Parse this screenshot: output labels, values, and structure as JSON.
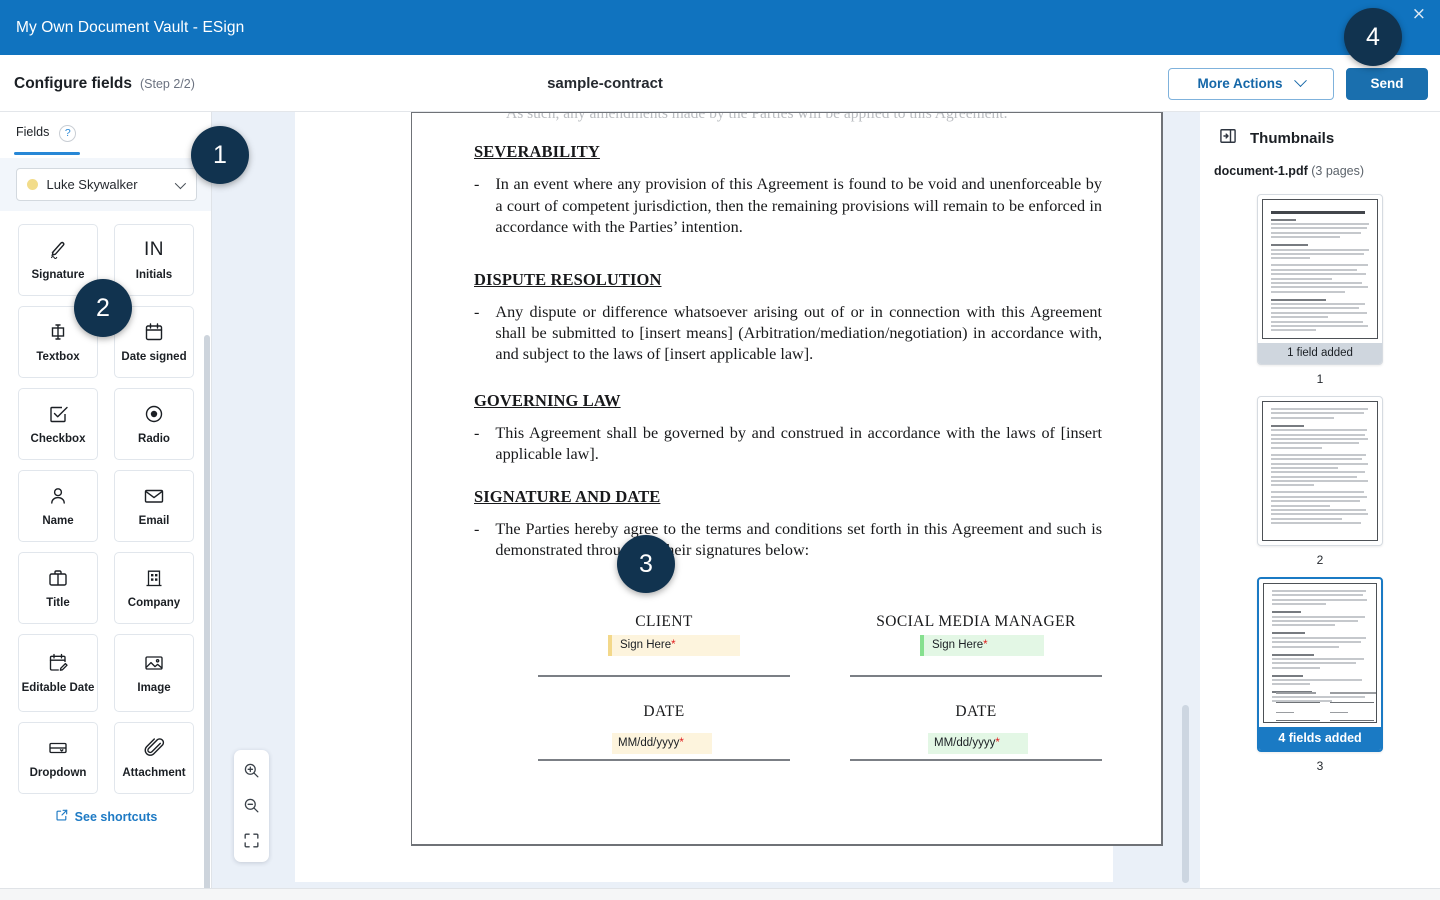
{
  "titlebar": {
    "title": "My Own Document Vault - ESign",
    "close_icon": "close-icon",
    "close_glyph": "×",
    "bg_color": "#1073bf"
  },
  "header": {
    "step_title": "Configure fields",
    "step_sub": "(Step 2/2)",
    "document_name": "sample-contract",
    "more_actions_label": "More Actions",
    "send_label": "Send",
    "send_color": "#1a6fae"
  },
  "left_panel": {
    "tab_label": "Fields",
    "help_glyph": "?",
    "recipient": {
      "name": "Luke Skywalker",
      "color": "#f2dc8a"
    },
    "fields": [
      {
        "label": "Signature",
        "icon": "signature-icon"
      },
      {
        "label": "Initials",
        "icon": "initials-icon",
        "glyph": "IN"
      },
      {
        "label": "Textbox",
        "icon": "textbox-icon"
      },
      {
        "label": "Date signed",
        "icon": "calendar-icon"
      },
      {
        "label": "Checkbox",
        "icon": "checkbox-icon"
      },
      {
        "label": "Radio",
        "icon": "radio-icon"
      },
      {
        "label": "Name",
        "icon": "person-icon"
      },
      {
        "label": "Email",
        "icon": "envelope-icon"
      },
      {
        "label": "Title",
        "icon": "briefcase-icon"
      },
      {
        "label": "Company",
        "icon": "building-icon"
      },
      {
        "label": "Editable Date",
        "icon": "editable-date-icon"
      },
      {
        "label": "Image",
        "icon": "image-icon"
      },
      {
        "label": "Dropdown",
        "icon": "dropdown-icon"
      },
      {
        "label": "Attachment",
        "icon": "paperclip-icon"
      }
    ],
    "see_shortcuts_label": "See shortcuts"
  },
  "viewer": {
    "faded_line": "As such, any amendments made by the Parties will be applied to this Agreement.",
    "sections": [
      {
        "heading": "SEVERABILITY",
        "body": "In an event where any provision of this Agreement is found to be void and unenforceable by a court of competent jurisdiction, then the remaining provisions will remain to be enforced in accordance with the Parties’ intention."
      },
      {
        "heading": "DISPUTE RESOLUTION",
        "body": "Any dispute or difference whatsoever arising out of or in connection with this Agreement shall be submitted to [insert means] (Arbitration/mediation/negotiation) in accordance with, and subject to the laws of [insert applicable law]."
      },
      {
        "heading": "GOVERNING LAW",
        "body": "This Agreement shall be governed by and construed in accordance with the laws of [insert applicable law]."
      },
      {
        "heading": "SIGNATURE AND DATE",
        "body": "The Parties hereby agree to the terms and conditions set forth in this Agreement and such is demonstrated throughout their signatures below:"
      }
    ],
    "signature_block": {
      "left": {
        "party_label": "CLIENT",
        "sign_tag": "Sign Here",
        "date_label": "DATE",
        "date_tag": "MM/dd/yyyy",
        "required_marker": "*",
        "color": "#fdf4dd"
      },
      "right": {
        "party_label": "SOCIAL MEDIA MANAGER",
        "sign_tag": "Sign Here",
        "date_label": "DATE",
        "date_tag": "MM/dd/yyyy",
        "required_marker": "*",
        "color": "#e3f7e5"
      }
    },
    "zoom_controls": [
      {
        "name": "zoom-in-icon"
      },
      {
        "name": "zoom-out-icon"
      },
      {
        "name": "fit-screen-icon"
      }
    ]
  },
  "thumbnails": {
    "panel_icon": "panel-toggle-icon",
    "title": "Thumbnails",
    "file_name": "document-1.pdf",
    "page_count_label": "(3 pages)",
    "pages": [
      {
        "number": "1",
        "badge": "1 field added",
        "selected": false
      },
      {
        "number": "2",
        "badge": "",
        "selected": false
      },
      {
        "number": "3",
        "badge": "4 fields added",
        "selected": true
      }
    ]
  },
  "callouts": [
    {
      "id": "1",
      "label": "1"
    },
    {
      "id": "2",
      "label": "2"
    },
    {
      "id": "3",
      "label": "3"
    },
    {
      "id": "4",
      "label": "4"
    }
  ]
}
